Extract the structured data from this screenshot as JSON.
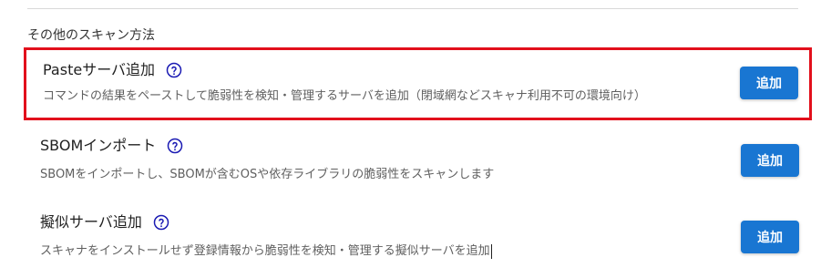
{
  "section": {
    "title": "その他のスキャン方法"
  },
  "items": [
    {
      "title": "Pasteサーバ追加",
      "description": "コマンドの結果をペーストして脆弱性を検知・管理するサーバを追加（閉域網などスキャナ利用不可の環境向け）",
      "button_label": "追加",
      "help_icon": "help-circle-icon",
      "highlighted": true
    },
    {
      "title": "SBOMインポート",
      "description": "SBOMをインポートし、SBOMが含むOSや依存ライブラリの脆弱性をスキャンします",
      "button_label": "追加",
      "help_icon": "help-circle-icon"
    },
    {
      "title": "擬似サーバ追加",
      "description": "スキャナをインストールせず登録情報から脆弱性を検知・管理する擬似サーバを追加",
      "button_label": "追加",
      "help_icon": "help-circle-icon"
    }
  ],
  "colors": {
    "accent": "#1976d2",
    "highlight_border": "#e2101c",
    "help_icon": "#1a1ab3"
  }
}
